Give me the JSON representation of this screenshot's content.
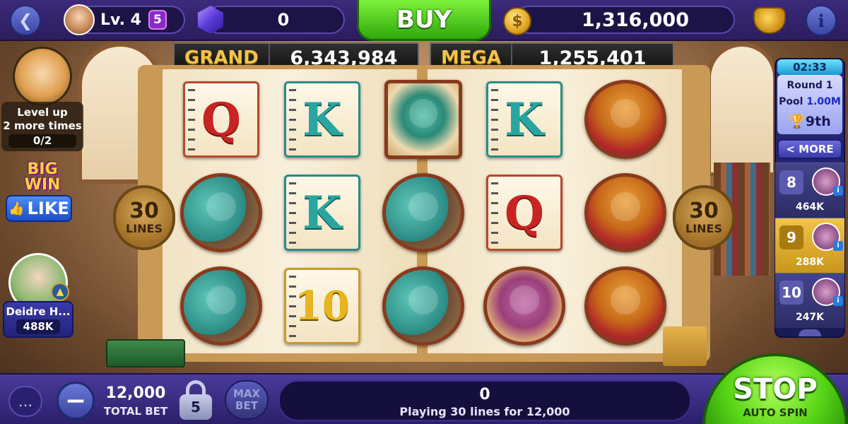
{
  "topbar": {
    "back_icon": "chevron-left-icon",
    "level": "Lv. 4",
    "level_badge": "5",
    "gems": "0",
    "buy_label": "BUY",
    "coins": "1,316,000",
    "info_label": "i"
  },
  "jackpots": {
    "grand_label": "GRAND",
    "grand_value": "6,343,984",
    "mega_label": "MEGA",
    "mega_value": "1,255,401"
  },
  "lines_badge": {
    "number": "30",
    "text": "LINES"
  },
  "reels": [
    [
      {
        "type": "letter",
        "symbol": "Q",
        "color": "red"
      },
      {
        "type": "character",
        "symbol": "turtle"
      },
      {
        "type": "character",
        "symbol": "turtle"
      }
    ],
    [
      {
        "type": "letter",
        "symbol": "K",
        "color": "teal"
      },
      {
        "type": "letter",
        "symbol": "K",
        "color": "teal"
      },
      {
        "type": "letter",
        "symbol": "10",
        "color": "gold"
      }
    ],
    [
      {
        "type": "character",
        "symbol": "dragon"
      },
      {
        "type": "character",
        "symbol": "turtle"
      },
      {
        "type": "character",
        "symbol": "turtle"
      }
    ],
    [
      {
        "type": "letter",
        "symbol": "K",
        "color": "teal"
      },
      {
        "type": "letter",
        "symbol": "Q",
        "color": "red"
      },
      {
        "type": "character",
        "symbol": "lady"
      }
    ],
    [
      {
        "type": "character",
        "symbol": "monster"
      },
      {
        "type": "character",
        "symbol": "monster"
      },
      {
        "type": "character",
        "symbol": "monster"
      }
    ]
  ],
  "left_panel": {
    "levelup_line1": "Level up",
    "levelup_line2": "2 more times",
    "levelup_progress": "0/2",
    "bigwin_text": "BIG WIN",
    "like_label": "LIKE",
    "friend_name": "Deidre H...",
    "friend_coins": "488K"
  },
  "tournament": {
    "timer": "02:33",
    "round": "Round 1",
    "pool_label": "Pool",
    "pool_value": "1.00M",
    "rank": "9th",
    "more_label": "< MORE",
    "players": [
      {
        "rank": "8",
        "score": "464K",
        "me": false
      },
      {
        "rank": "9",
        "score": "288K",
        "me": true
      },
      {
        "rank": "10",
        "score": "247K",
        "me": false
      }
    ]
  },
  "bottombar": {
    "total_bet": "12,000",
    "total_bet_label": "TOTAL BET",
    "lock_level": "5",
    "max_bet_line1": "MAX",
    "max_bet_line2": "BET",
    "win": "0",
    "lines_text": "Playing 30 lines for 12,000",
    "stop_label": "STOP",
    "auto_spin_label": "AUTO SPIN"
  },
  "colors": {
    "buy_green": "#2fa80c",
    "topbar_purple": "#3b2a7a",
    "jackpot_gold": "#f3c34a"
  }
}
